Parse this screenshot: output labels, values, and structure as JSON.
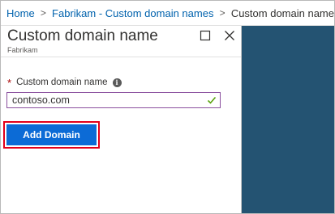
{
  "breadcrumb": {
    "items": [
      "Home",
      "Fabrikam - Custom domain names"
    ],
    "current": "Custom domain name",
    "separator": ">"
  },
  "blade": {
    "title": "Custom domain name",
    "subtitle": "Fabrikam",
    "maximize_icon": "maximize-icon",
    "close_icon": "close-icon"
  },
  "form": {
    "required_marker": "*",
    "field_label": "Custom domain name",
    "info_icon": "info-icon",
    "input_value": "contoso.com",
    "validation_icon": "checkmark-icon",
    "add_button_label": "Add Domain"
  },
  "colors": {
    "link": "#0062ad",
    "button": "#0c6bd6",
    "highlight": "#e3001b",
    "input_border": "#8a4f9e",
    "valid_check": "#5aa30f",
    "dark_area": "#245372"
  }
}
